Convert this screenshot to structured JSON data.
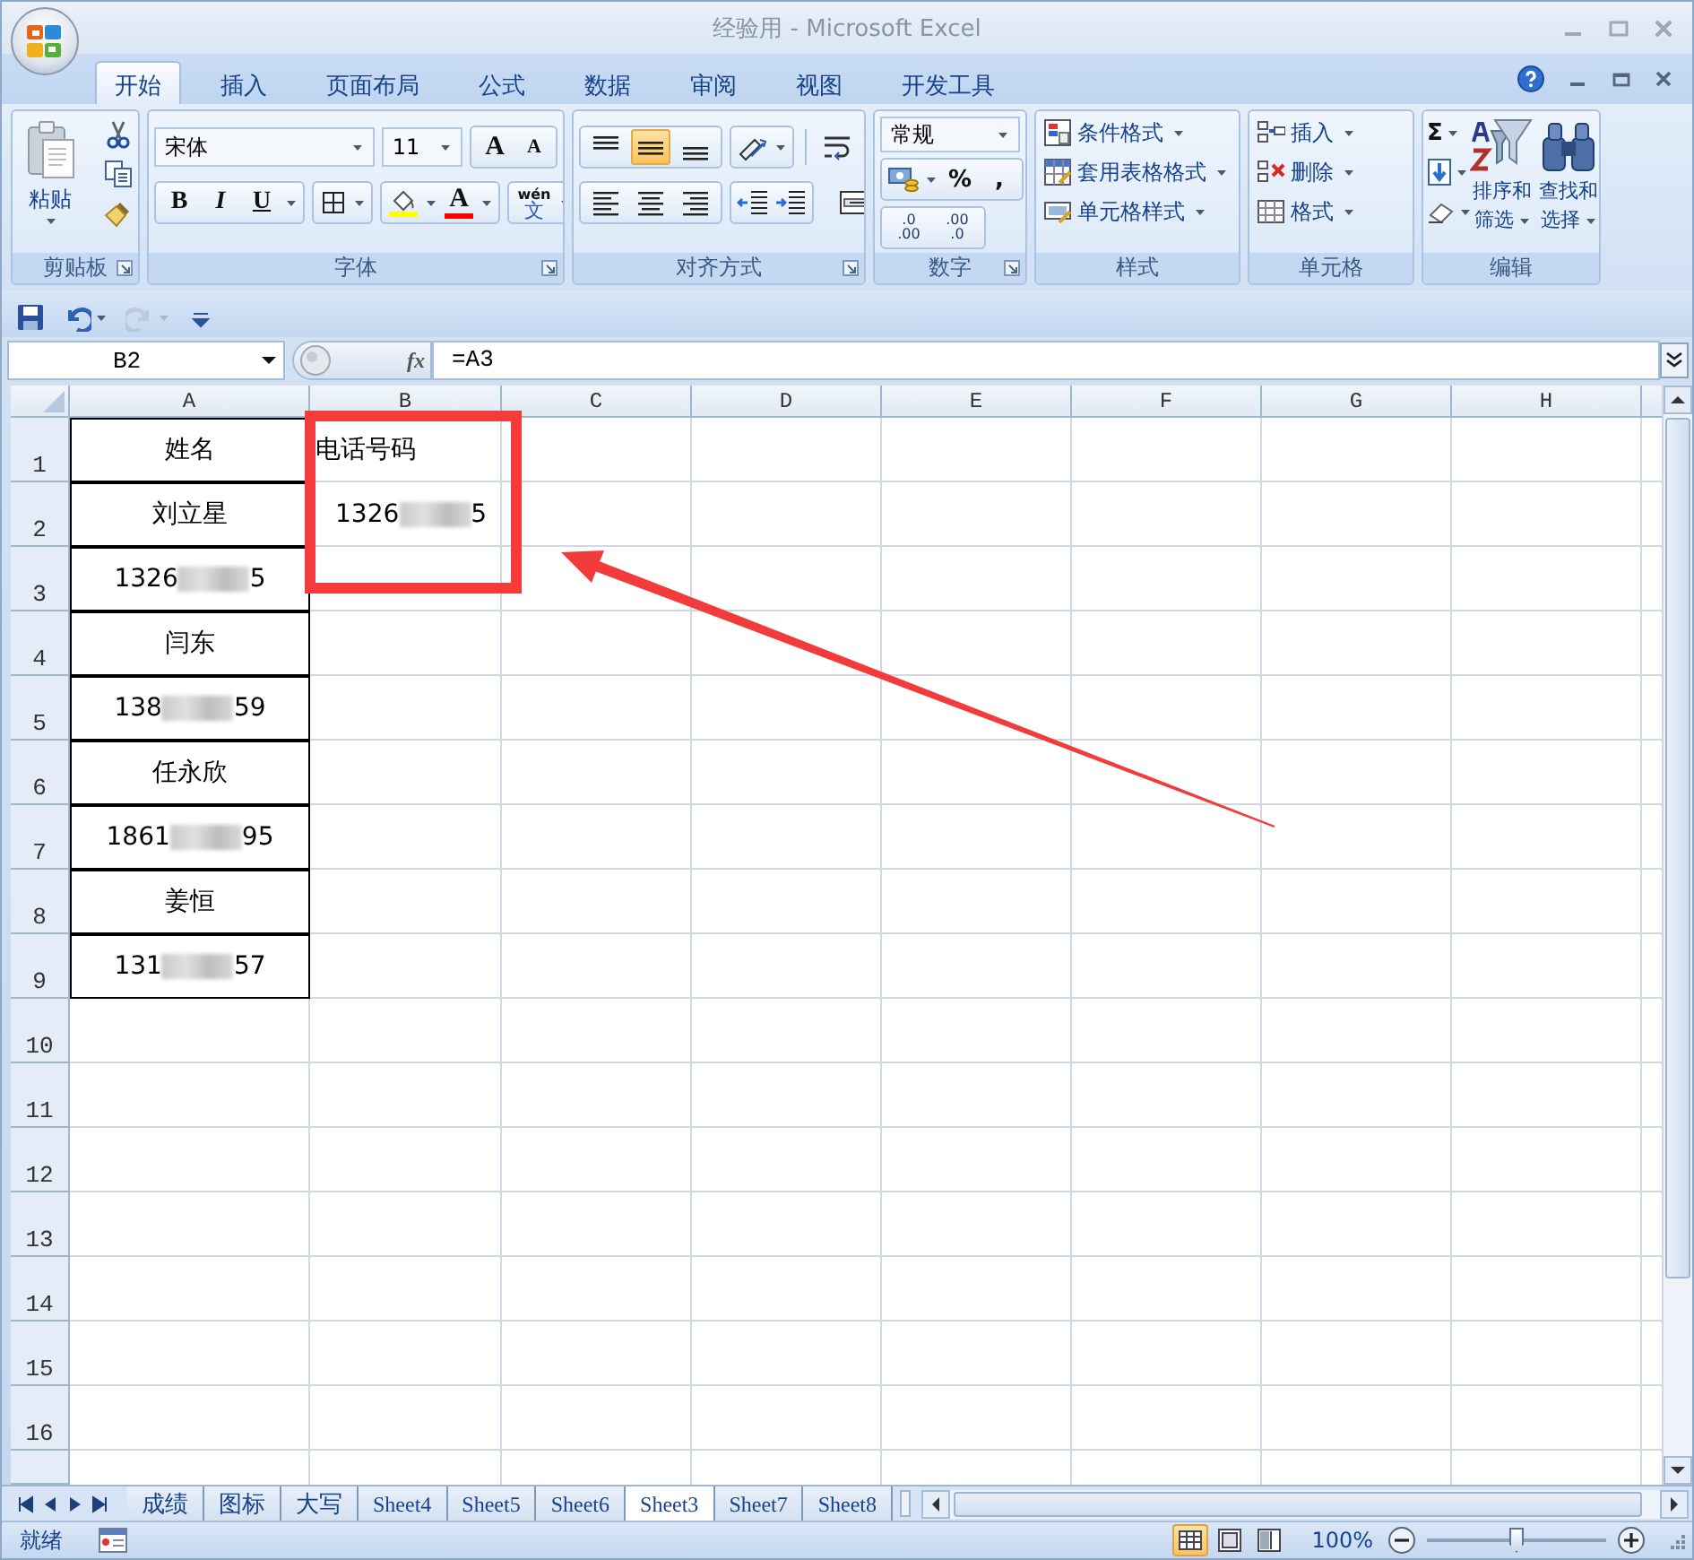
{
  "window": {
    "title": "经验用 - Microsoft Excel"
  },
  "ribbon_tabs": [
    {
      "label": "开始",
      "selected": true
    },
    {
      "label": "插入",
      "selected": false
    },
    {
      "label": "页面布局",
      "selected": false
    },
    {
      "label": "公式",
      "selected": false
    },
    {
      "label": "数据",
      "selected": false
    },
    {
      "label": "审阅",
      "selected": false
    },
    {
      "label": "视图",
      "selected": false
    },
    {
      "label": "开发工具",
      "selected": false
    }
  ],
  "ribbon": {
    "clipboard": {
      "paste": "粘贴",
      "label": "剪贴板",
      "dialog_launcher": true
    },
    "font": {
      "name": "宋体",
      "size": "11",
      "grow": "A",
      "shrink": "A",
      "styles": [
        {
          "kind": "bold",
          "label": "B"
        },
        {
          "kind": "italic",
          "label": "I"
        },
        {
          "kind": "underline",
          "label": "U"
        }
      ],
      "font_color": {
        "label": "A",
        "color": "#ff0000"
      },
      "fill_color": {
        "color": "#ffff00"
      },
      "phonetic": {
        "top": "wén",
        "bottom": "文"
      },
      "label": "字体",
      "dialog_launcher": true
    },
    "alignment": {
      "vertical": [
        {
          "kind": "top",
          "selected": false
        },
        {
          "kind": "middle",
          "selected": true
        },
        {
          "kind": "bottom",
          "selected": false
        }
      ],
      "horizontal": [
        {
          "kind": "left",
          "selected": false
        },
        {
          "kind": "center",
          "selected": false
        },
        {
          "kind": "right",
          "selected": false
        }
      ],
      "label": "对齐方式",
      "dialog_launcher": true
    },
    "number": {
      "format": "常规",
      "percent": "%",
      "comma": ",",
      "decimals": [
        {
          "top": ".0",
          "bottom": ".00"
        },
        {
          "top": ".00",
          "bottom": ".0"
        }
      ],
      "label": "数字",
      "dialog_launcher": true
    },
    "styles": {
      "items": [
        {
          "kind": "conditional",
          "label": "条件格式"
        },
        {
          "kind": "table",
          "label": "套用表格格式"
        },
        {
          "kind": "cell",
          "label": "单元格样式"
        }
      ],
      "label": "样式"
    },
    "cells": {
      "items": [
        {
          "kind": "insert",
          "label": "插入"
        },
        {
          "kind": "delete",
          "label": "删除"
        },
        {
          "kind": "format",
          "label": "格式"
        }
      ],
      "label": "单元格"
    },
    "editing": {
      "sum": "Σ",
      "sort": {
        "line1": "排序和",
        "line2": "筛选"
      },
      "find": {
        "line1": "查找和",
        "line2": "选择"
      },
      "label": "编辑"
    }
  },
  "quick_access": [
    {
      "kind": "save",
      "disabled": false
    },
    {
      "kind": "undo",
      "disabled": false
    },
    {
      "kind": "redo",
      "disabled": true
    },
    {
      "kind": "customize",
      "disabled": false
    }
  ],
  "formula_bar": {
    "name_box": "B2",
    "fx": "fx",
    "formula": "=A3"
  },
  "sheet": {
    "columns": [
      "A",
      "B",
      "C",
      "D",
      "E",
      "F",
      "G",
      "H"
    ],
    "rows": [
      {
        "number": "1",
        "cells": [
          {
            "kind": "text",
            "text": "姓名",
            "bordered": true
          },
          {
            "kind": "text",
            "text": "电话号码",
            "bordered": false
          }
        ]
      },
      {
        "number": "2",
        "cells": [
          {
            "kind": "text",
            "text": "刘立星",
            "bordered": true
          },
          {
            "kind": "masked",
            "prefix": "1326",
            "suffix": "5",
            "bordered": false
          }
        ]
      },
      {
        "number": "3",
        "cells": [
          {
            "kind": "masked",
            "prefix": "1326",
            "suffix": "5",
            "bordered": true
          }
        ]
      },
      {
        "number": "4",
        "cells": [
          {
            "kind": "text",
            "text": "闫东",
            "bordered": true
          }
        ]
      },
      {
        "number": "5",
        "cells": [
          {
            "kind": "masked",
            "prefix": "138",
            "suffix": "59",
            "bordered": true
          }
        ]
      },
      {
        "number": "6",
        "cells": [
          {
            "kind": "text",
            "text": "任永欣",
            "bordered": true
          }
        ]
      },
      {
        "number": "7",
        "cells": [
          {
            "kind": "masked",
            "prefix": "1861",
            "suffix": "95",
            "bordered": true
          }
        ]
      },
      {
        "number": "8",
        "cells": [
          {
            "kind": "text",
            "text": "姜恒",
            "bordered": true
          }
        ]
      },
      {
        "number": "9",
        "cells": [
          {
            "kind": "masked",
            "prefix": "131",
            "suffix": "57",
            "bordered": true
          }
        ]
      },
      {
        "number": "10",
        "cells": []
      },
      {
        "number": "11",
        "cells": []
      },
      {
        "number": "12",
        "cells": []
      },
      {
        "number": "13",
        "cells": []
      },
      {
        "number": "14",
        "cells": []
      },
      {
        "number": "15",
        "cells": []
      },
      {
        "number": "16",
        "cells": []
      }
    ]
  },
  "annotations": {
    "highlight_frame": true,
    "arrow": true
  },
  "sheet_tabs": [
    {
      "label": "成绩",
      "selected": false
    },
    {
      "label": "图标",
      "selected": false
    },
    {
      "label": "大写",
      "selected": false
    },
    {
      "label": "Sheet4",
      "selected": false
    },
    {
      "label": "Sheet5",
      "selected": false
    },
    {
      "label": "Sheet6",
      "selected": false
    },
    {
      "label": "Sheet3",
      "selected": true
    },
    {
      "label": "Sheet7",
      "selected": false
    },
    {
      "label": "Sheet8",
      "selected": false
    }
  ],
  "status_bar": {
    "status": "就绪",
    "views": [
      {
        "kind": "normal",
        "selected": true
      },
      {
        "kind": "page_layout",
        "selected": false
      },
      {
        "kind": "page_break",
        "selected": false
      }
    ],
    "zoom": {
      "label": "100%",
      "level": 0.5
    }
  }
}
